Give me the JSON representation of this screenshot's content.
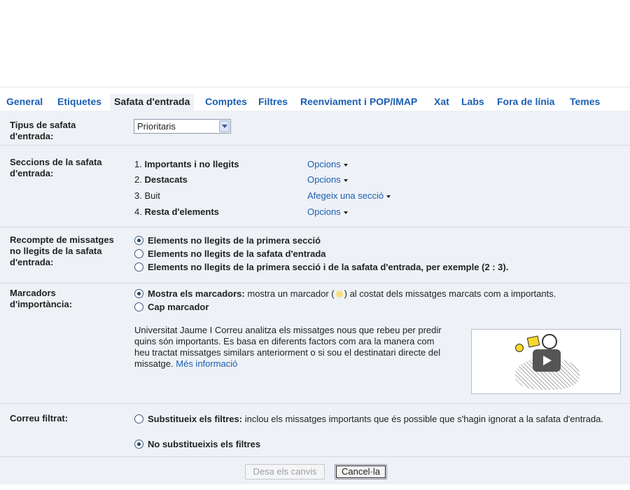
{
  "tabs": [
    {
      "label": "General",
      "active": false
    },
    {
      "label": "Etiquetes",
      "active": false
    },
    {
      "label": "Safata d'entrada",
      "active": true
    },
    {
      "label": "Comptes",
      "active": false
    },
    {
      "label": "Filtres",
      "active": false
    },
    {
      "label": "Reenviament i POP/IMAP",
      "active": false
    },
    {
      "label": "Xat",
      "active": false
    },
    {
      "label": "Labs",
      "active": false
    },
    {
      "label": "Fora de línia",
      "active": false
    },
    {
      "label": "Temes",
      "active": false
    }
  ],
  "inbox_type": {
    "label": "Tipus de safata d'entrada:",
    "selected": "Prioritaris"
  },
  "inbox_sections": {
    "label": "Seccions de la safata d'entrada:",
    "items": [
      {
        "num": "1.",
        "name": "Importants i no llegits",
        "action": "Opcions"
      },
      {
        "num": "2.",
        "name": "Destacats",
        "action": "Opcions"
      },
      {
        "num": "3.",
        "name": "Buit",
        "action": "Afegeix una secció"
      },
      {
        "num": "4.",
        "name": "Resta d'elements",
        "action": "Opcions"
      }
    ]
  },
  "unread_count": {
    "label": "Recompte de missatges no llegits de la safata d'entrada:",
    "options": [
      {
        "text": "Elements no llegits de la primera secció",
        "selected": true
      },
      {
        "text": "Elements no llegits de la safata d'entrada",
        "selected": false
      },
      {
        "text": "Elements no llegits de la primera secció i de la safata d'entrada, per exemple (2 : 3).",
        "selected": false
      }
    ]
  },
  "importance_markers": {
    "label": "Marcadors d'importància:",
    "show_option": {
      "title": "Mostra els marcadors:",
      "text_before": "mostra un marcador (",
      "text_after": ") al costat dels missatges marcats com a importants.",
      "selected": true
    },
    "none_option": {
      "title": "Cap marcador",
      "selected": false
    },
    "description": "Universitat Jaume I Correu analitza els missatges nous que rebeu per predir quins són importants. Es basa en diferents factors com ara la manera com heu tractat missatges similars anteriorment o si sou el destinatari directe del missatge.",
    "learn_more": "Més informació",
    "video_icon": "play-video-icon",
    "marker_color": "#f7e27a"
  },
  "filtered_mail": {
    "label": "Correu filtrat:",
    "override": {
      "title": "Substitueix els filtres:",
      "text": "inclou els missatges importants que és possible que s'hagin ignorat a la safata d'entrada.",
      "selected": false
    },
    "no_override": {
      "title": "No substitueixis els filtres",
      "selected": true
    }
  },
  "buttons": {
    "save": "Desa els canvis",
    "cancel": "Cancel·la"
  },
  "colors": {
    "link": "#1a5fb4",
    "panel_bg": "#eef1f6"
  }
}
